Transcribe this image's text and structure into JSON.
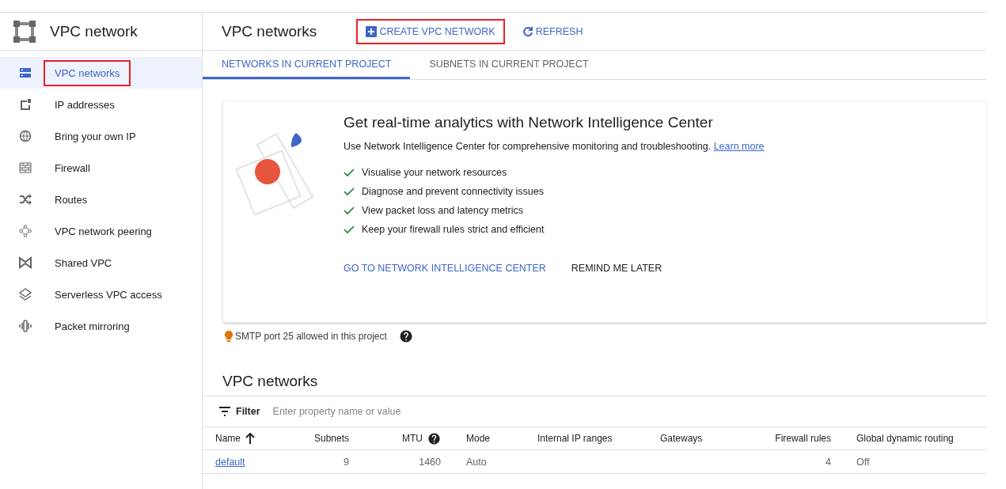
{
  "product": {
    "title": "VPC network"
  },
  "sidebar": {
    "items": [
      {
        "label": "VPC networks",
        "selected": true,
        "highlighted": true
      },
      {
        "label": "IP addresses",
        "selected": false,
        "highlighted": false
      },
      {
        "label": "Bring your own IP",
        "selected": false,
        "highlighted": false
      },
      {
        "label": "Firewall",
        "selected": false,
        "highlighted": false
      },
      {
        "label": "Routes",
        "selected": false,
        "highlighted": false
      },
      {
        "label": "VPC network peering",
        "selected": false,
        "highlighted": false
      },
      {
        "label": "Shared VPC",
        "selected": false,
        "highlighted": false
      },
      {
        "label": "Serverless VPC access",
        "selected": false,
        "highlighted": false
      },
      {
        "label": "Packet mirroring",
        "selected": false,
        "highlighted": false
      }
    ]
  },
  "header": {
    "title": "VPC networks",
    "actions": [
      {
        "label": "CREATE VPC NETWORK",
        "highlighted": true
      },
      {
        "label": "REFRESH",
        "highlighted": false
      }
    ]
  },
  "tabs": [
    {
      "label": "NETWORKS IN CURRENT PROJECT",
      "selected": true
    },
    {
      "label": "SUBNETS IN CURRENT PROJECT",
      "selected": false
    }
  ],
  "promo": {
    "title": "Get real-time analytics with Network Intelligence Center",
    "description": "Use Network Intelligence Center for comprehensive monitoring and troubleshooting.",
    "link": "Learn more",
    "features": [
      "Visualise your network resources",
      "Diagnose and prevent connectivity issues",
      "View packet loss and latency metrics",
      "Keep your firewall rules strict and efficient"
    ],
    "actions": [
      {
        "label": "GO TO NETWORK INTELLIGENCE CENTER",
        "primary": true
      },
      {
        "label": "REMIND ME LATER",
        "primary": false
      }
    ]
  },
  "notice": {
    "text": "SMTP port 25 allowed in this project"
  },
  "section": {
    "title": "VPC networks"
  },
  "filter": {
    "label": "Filter",
    "placeholder": "Enter property name or value"
  },
  "table": {
    "columns": [
      {
        "label": "Name",
        "sorted": true,
        "help": false
      },
      {
        "label": "Subnets",
        "sorted": false,
        "help": false
      },
      {
        "label": "MTU",
        "sorted": false,
        "help": true
      },
      {
        "label": "Mode",
        "sorted": false,
        "help": false
      },
      {
        "label": "Internal IP ranges",
        "sorted": false,
        "help": false
      },
      {
        "label": "Gateways",
        "sorted": false,
        "help": false
      },
      {
        "label": "Firewall rules",
        "sorted": false,
        "help": false
      },
      {
        "label": "Global dynamic routing",
        "sorted": false,
        "help": false
      }
    ],
    "rows": [
      [
        "default",
        "9",
        "1460",
        "Auto",
        "",
        "",
        "4",
        "Off"
      ]
    ]
  }
}
